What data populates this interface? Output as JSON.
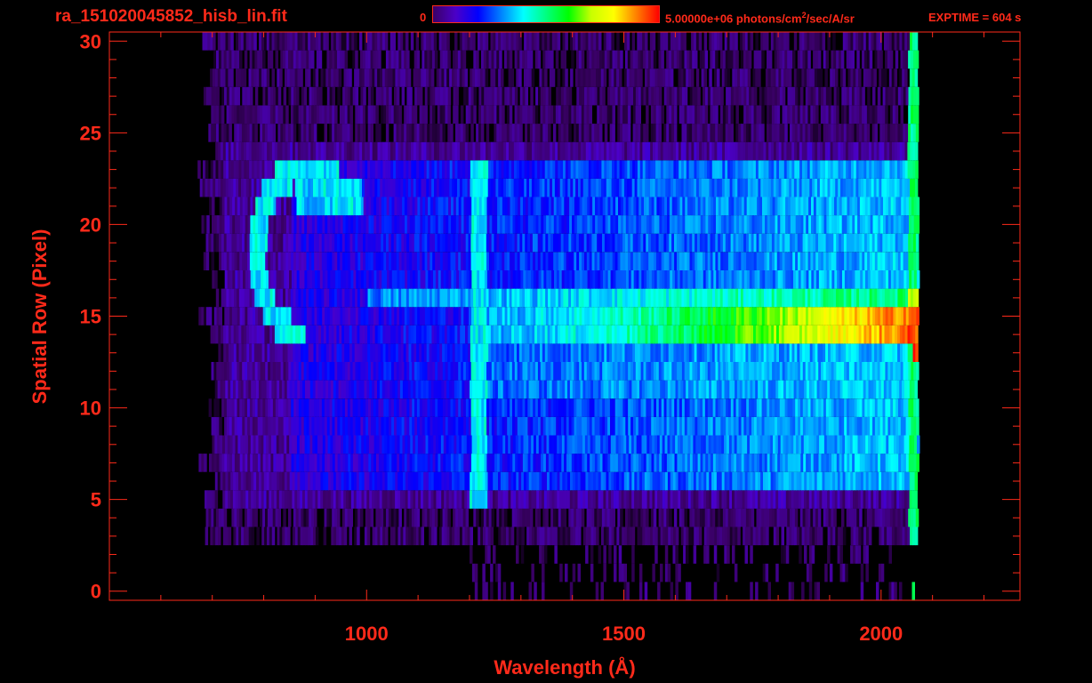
{
  "header": {
    "file_title": "ra_151020045852_hisb_lin.fit",
    "colorbar_min": "0",
    "colorbar_max_value": "5.00000e+06",
    "colorbar_units": " photons/cm",
    "colorbar_units_sup": "2",
    "colorbar_units_tail": "/sec/A/sr",
    "exptime": "EXPTIME = 604 s"
  },
  "colors": {
    "axis": "#ff2a1a",
    "background": "#000000",
    "colormap": [
      "#000000",
      "#3a0066",
      "#4b00c8",
      "#0000ff",
      "#0080ff",
      "#00ffff",
      "#00ff80",
      "#00ff00",
      "#c8ff00",
      "#ffff00",
      "#ff8000",
      "#ff0000"
    ]
  },
  "chart_data": {
    "type": "heatmap",
    "title": "ra_151020045852_hisb_lin.fit",
    "xlabel": "Wavelength (Å)",
    "ylabel": "Spatial Row (Pixel)",
    "xlim": [
      500,
      2270
    ],
    "ylim": [
      -0.5,
      30.5
    ],
    "x_ticks": [
      1000,
      1500,
      2000
    ],
    "y_ticks": [
      0,
      5,
      10,
      15,
      20,
      25,
      30
    ],
    "colorbar": {
      "min": 0,
      "max": 5000000,
      "units": "photons/cm^2/sec/A/sr"
    },
    "image_extent": {
      "x": [
        690,
        2070
      ],
      "rows": [
        0,
        30
      ]
    },
    "features": [
      {
        "name": "Lyman-alpha line",
        "x": 1216,
        "rows": [
          5,
          23
        ],
        "level": 0.45
      },
      {
        "name": "bright continuum band",
        "x_range": [
          1200,
          2070
        ],
        "rows": [
          14,
          15
        ],
        "level_start": 0.4,
        "level_end": 0.95
      },
      {
        "name": "curved order",
        "x_range": [
          780,
          1000
        ],
        "rows": [
          14,
          23
        ],
        "level": 0.45
      },
      {
        "name": "red edge",
        "x": 2060,
        "rows": [
          0,
          30
        ],
        "level": 0.55
      }
    ]
  }
}
